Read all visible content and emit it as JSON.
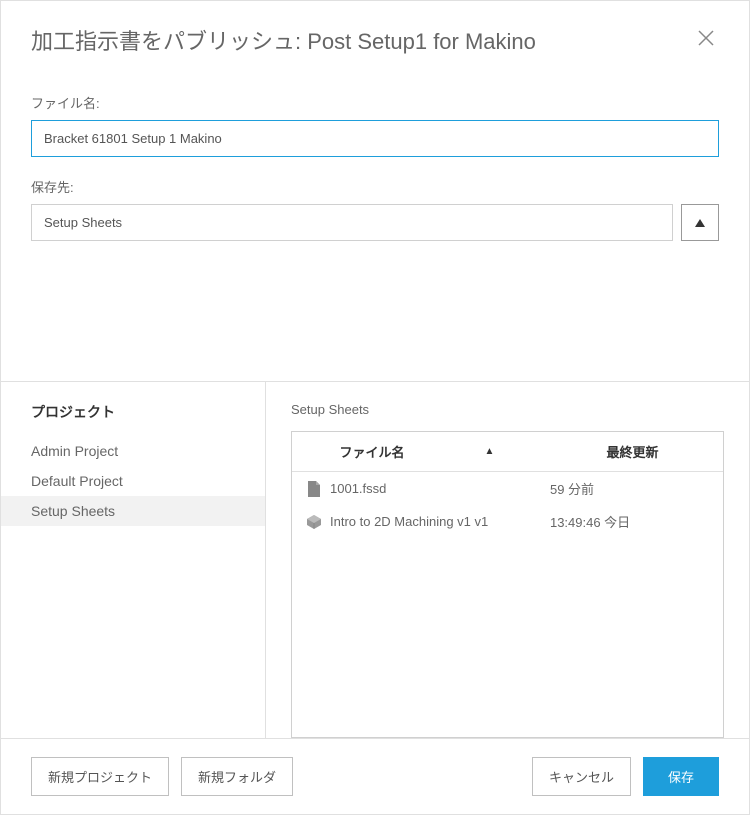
{
  "dialog": {
    "title": "加工指示書をパブリッシュ: Post Setup1 for Makino"
  },
  "fields": {
    "filename_label": "ファイル名:",
    "filename_value": "Bracket 61801 Setup 1 Makino",
    "save_label": "保存先:",
    "save_value": "Setup Sheets"
  },
  "sidebar": {
    "title": "プロジェクト",
    "projects": [
      {
        "name": "Admin Project",
        "selected": false
      },
      {
        "name": "Default Project",
        "selected": false
      },
      {
        "name": "Setup Sheets",
        "selected": true
      }
    ]
  },
  "browser": {
    "breadcrumb": "Setup Sheets",
    "columns": {
      "name": "ファイル名",
      "date": "最終更新"
    },
    "files": [
      {
        "icon": "file",
        "name": "1001.fssd",
        "date": "59 分前"
      },
      {
        "icon": "cube",
        "name": "Intro to 2D Machining v1 v1",
        "date": "13:49:46 今日"
      }
    ]
  },
  "footer": {
    "new_project": "新規プロジェクト",
    "new_folder": "新規フォルダ",
    "cancel": "キャンセル",
    "save": "保存"
  }
}
